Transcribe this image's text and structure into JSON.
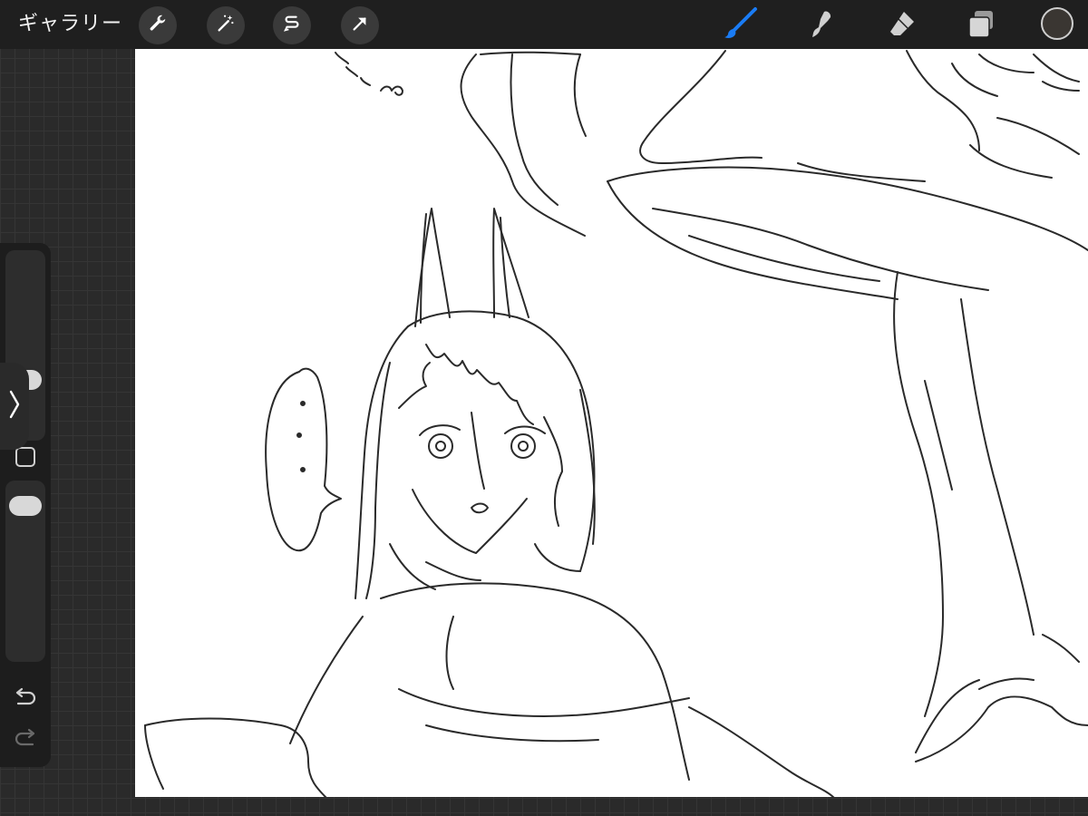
{
  "topbar": {
    "gallery_label": "ギャラリー",
    "left_tools": [
      {
        "name": "wrench-icon"
      },
      {
        "name": "magic-wand-icon"
      },
      {
        "name": "selection-icon"
      },
      {
        "name": "transform-arrow-icon"
      }
    ],
    "right_tools": [
      {
        "name": "brush-icon",
        "active": true
      },
      {
        "name": "smudge-icon"
      },
      {
        "name": "eraser-icon"
      },
      {
        "name": "layers-icon"
      }
    ],
    "current_color": "#3a3632",
    "accent_color": "#1a7cf5"
  },
  "sidebar": {
    "brush_size_level": 0.25,
    "opacity_level": 0.1,
    "collapse_icon": "chevron-right-icon",
    "modify_button_icon": "square-icon",
    "undo_icon": "undo-icon",
    "redo_icon": "redo-icon"
  },
  "canvas": {
    "background": "#ffffff",
    "content": "sketch"
  }
}
